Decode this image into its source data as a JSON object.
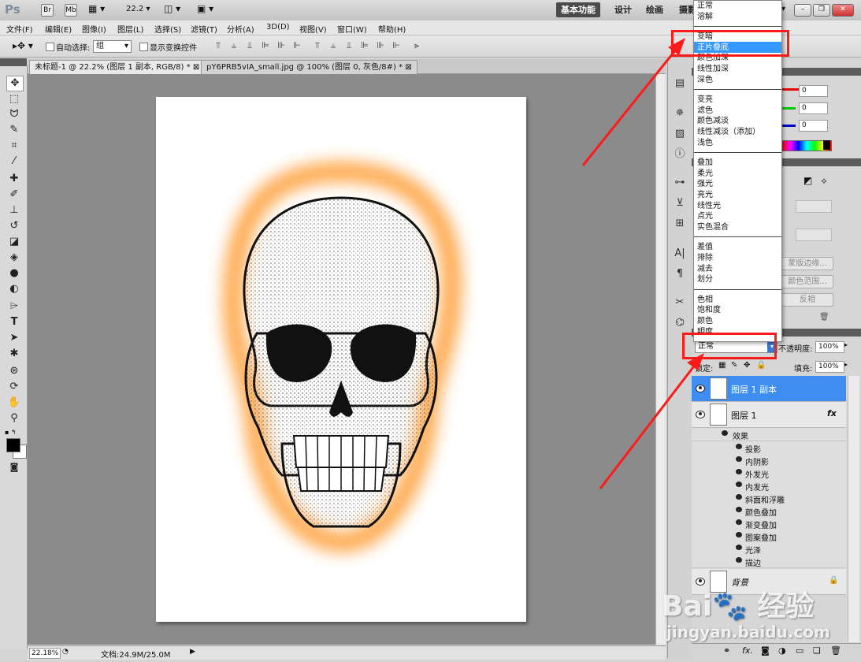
{
  "app": {
    "logo": "Ps",
    "bridge": "Br",
    "mini_bridge": "Mb",
    "zoom": "22.2"
  },
  "workspaces": [
    "基本功能",
    "设计",
    "绘画",
    "摄影"
  ],
  "menu": [
    "文件(F)",
    "编辑(E)",
    "图像(I)",
    "图层(L)",
    "选择(S)",
    "滤镜(T)",
    "分析(A)",
    "3D(D)",
    "视图(V)",
    "窗口(W)",
    "帮助(H)"
  ],
  "options": {
    "auto_select_label": "自动选择:",
    "auto_select_value": "组",
    "show_transform_label": "显示变换控件"
  },
  "tabs": [
    "未标题-1 @ 22.2% (图层 1 副本, RGB/8) *",
    "pY6PRB5vIA_small.jpg @ 100% (图层 0, 灰色/8#) *"
  ],
  "status": {
    "zoom": "22.18%",
    "doc": "文档:24.9M/25.0M"
  },
  "color_panel": {
    "r": "0",
    "g": "0",
    "b": "0"
  },
  "mask_panel": {
    "btn1": "蒙版边缘...",
    "btn2": "颜色范围...",
    "btn3": "反相"
  },
  "blend_groups": [
    [
      "正常",
      "溶解"
    ],
    [
      "变暗",
      "正片叠底",
      "颜色加深",
      "线性加深",
      "深色"
    ],
    [
      "变亮",
      "滤色",
      "颜色减淡",
      "线性减淡（添加）",
      "浅色"
    ],
    [
      "叠加",
      "柔光",
      "强光",
      "亮光",
      "线性光",
      "点光",
      "实色混合"
    ],
    [
      "差值",
      "排除",
      "减去",
      "划分"
    ],
    [
      "色相",
      "饱和度",
      "颜色",
      "明度"
    ]
  ],
  "layers_panel": {
    "blend_mode": "正常",
    "opacity_label": "不透明度:",
    "opacity": "100%",
    "lock_label": "锁定:",
    "fill_label": "填充:",
    "fill": "100%",
    "layers": [
      {
        "name": "图层 1 副本",
        "selected": true
      },
      {
        "name": "图层 1",
        "fx": "fx"
      }
    ],
    "effects_label": "效果",
    "effects": [
      "投影",
      "内阴影",
      "外发光",
      "内发光",
      "斜面和浮雕",
      "颜色叠加",
      "渐变叠加",
      "图案叠加",
      "光泽",
      "描边"
    ],
    "background": "背景"
  },
  "watermark": {
    "brand": "Bai",
    "brand2": "经验",
    "url": "jingyan.baidu.com"
  }
}
